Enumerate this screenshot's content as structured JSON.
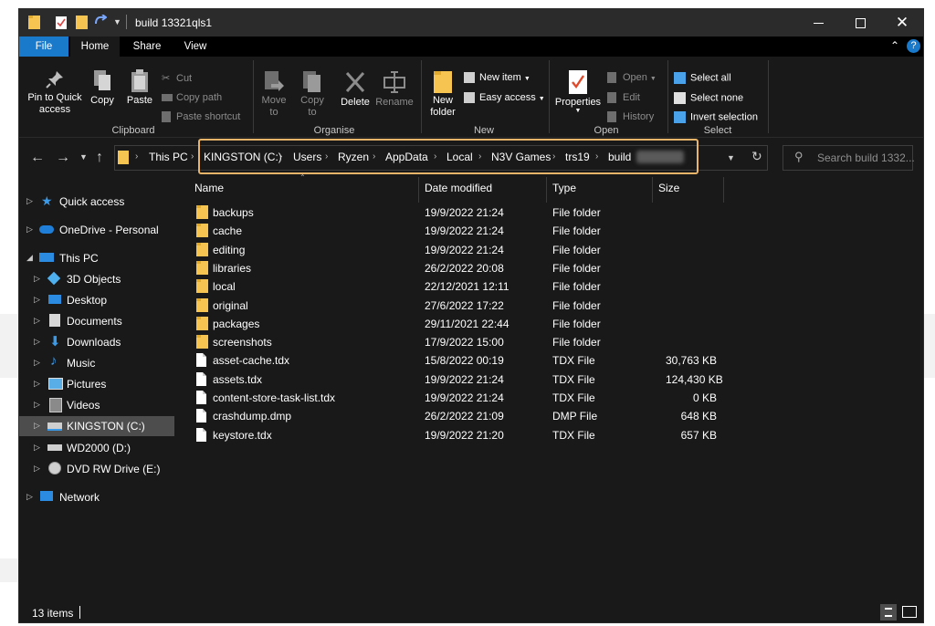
{
  "window": {
    "title": "build 13321qls1"
  },
  "tabs": [
    {
      "label": "File"
    },
    {
      "label": "Home"
    },
    {
      "label": "Share"
    },
    {
      "label": "View"
    }
  ],
  "ribbon": {
    "clipboard": {
      "group": "Clipboard",
      "pin": "Pin to Quick access",
      "copy": "Copy",
      "paste": "Paste",
      "cut": "Cut",
      "copy_path": "Copy path",
      "paste_shortcut": "Paste shortcut"
    },
    "organise": {
      "group": "Organise",
      "move_to": "Move to",
      "copy_to": "Copy to",
      "delete": "Delete",
      "rename": "Rename"
    },
    "new": {
      "group": "New",
      "new_folder": "New folder",
      "new_item": "New item",
      "easy_access": "Easy access"
    },
    "open": {
      "group": "Open",
      "properties": "Properties",
      "open": "Open",
      "edit": "Edit",
      "history": "History"
    },
    "select": {
      "group": "Select",
      "select_all": "Select all",
      "select_none": "Select none",
      "invert_selection": "Invert selection"
    }
  },
  "address": {
    "crumbs": [
      "This PC",
      "KINGSTON (C:)",
      "Users",
      "Ryzen",
      "AppData",
      "Local",
      "N3V Games",
      "trs19",
      "build"
    ],
    "search_placeholder": "Search build 1332..."
  },
  "nav": [
    {
      "label": "Quick access",
      "icon": "star-icon"
    },
    {
      "label": "OneDrive - Personal",
      "icon": "cloud-icon"
    },
    {
      "label": "This PC",
      "icon": "computer-icon"
    },
    {
      "label": "3D Objects",
      "icon": "cube-icon"
    },
    {
      "label": "Desktop",
      "icon": "desktop-icon"
    },
    {
      "label": "Documents",
      "icon": "documents-icon"
    },
    {
      "label": "Downloads",
      "icon": "download-icon"
    },
    {
      "label": "Music",
      "icon": "music-icon"
    },
    {
      "label": "Pictures",
      "icon": "pictures-icon"
    },
    {
      "label": "Videos",
      "icon": "videos-icon"
    },
    {
      "label": "KINGSTON (C:)",
      "icon": "drive-icon"
    },
    {
      "label": "WD2000 (D:)",
      "icon": "drive-icon"
    },
    {
      "label": "DVD RW Drive (E:)",
      "icon": "dvd-icon"
    },
    {
      "label": "Network",
      "icon": "network-icon"
    }
  ],
  "columns": {
    "name": "Name",
    "date": "Date modified",
    "type": "Type",
    "size": "Size"
  },
  "files": [
    {
      "name": "backups",
      "date": "19/9/2022 21:24",
      "type": "File folder",
      "size": "",
      "kind": "folder"
    },
    {
      "name": "cache",
      "date": "19/9/2022 21:24",
      "type": "File folder",
      "size": "",
      "kind": "folder"
    },
    {
      "name": "editing",
      "date": "19/9/2022 21:24",
      "type": "File folder",
      "size": "",
      "kind": "folder"
    },
    {
      "name": "libraries",
      "date": "26/2/2022 20:08",
      "type": "File folder",
      "size": "",
      "kind": "folder"
    },
    {
      "name": "local",
      "date": "22/12/2021 12:11",
      "type": "File folder",
      "size": "",
      "kind": "folder"
    },
    {
      "name": "original",
      "date": "27/6/2022 17:22",
      "type": "File folder",
      "size": "",
      "kind": "folder"
    },
    {
      "name": "packages",
      "date": "29/11/2021 22:44",
      "type": "File folder",
      "size": "",
      "kind": "folder"
    },
    {
      "name": "screenshots",
      "date": "17/9/2022 15:00",
      "type": "File folder",
      "size": "",
      "kind": "folder"
    },
    {
      "name": "asset-cache.tdx",
      "date": "15/8/2022 00:19",
      "type": "TDX File",
      "size": "30,763 KB",
      "kind": "file"
    },
    {
      "name": "assets.tdx",
      "date": "19/9/2022 21:24",
      "type": "TDX File",
      "size": "124,430 KB",
      "kind": "file"
    },
    {
      "name": "content-store-task-list.tdx",
      "date": "19/9/2022 21:24",
      "type": "TDX File",
      "size": "0 KB",
      "kind": "file"
    },
    {
      "name": "crashdump.dmp",
      "date": "26/2/2022 21:09",
      "type": "DMP File",
      "size": "648 KB",
      "kind": "file"
    },
    {
      "name": "keystore.tdx",
      "date": "19/9/2022 21:20",
      "type": "TDX File",
      "size": "657 KB",
      "kind": "file"
    }
  ],
  "status": {
    "count": "13 items"
  },
  "colors": {
    "accent": "#1979ca",
    "folder": "#f5c451",
    "highlight": "#e8b46a",
    "background": "#191919"
  }
}
